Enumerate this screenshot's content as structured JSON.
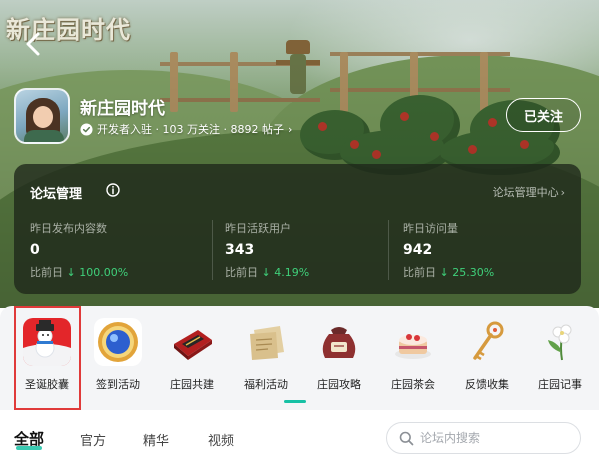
{
  "header": {
    "logo_text": "新庄园时代",
    "back_icon": "back-arrow-icon"
  },
  "forum": {
    "name": "新庄园时代",
    "verified_icon": "verified-shield-icon",
    "meta": "开发者入驻 · 103 万关注 · 8892 帖子",
    "meta_chevron": "›",
    "follow_label": "已关注"
  },
  "management": {
    "title": "论坛管理",
    "center_link": "论坛管理中心",
    "center_chevron": "›",
    "stats": [
      {
        "label": "昨日发布内容数",
        "value": "0",
        "change_prefix": "比前日",
        "change": "↓ 100.00%"
      },
      {
        "label": "昨日活跃用户",
        "value": "343",
        "change_prefix": "比前日",
        "change": "↓ 4.19%"
      },
      {
        "label": "昨日访问量",
        "value": "942",
        "change_prefix": "比前日",
        "change": "↓ 25.30%"
      }
    ]
  },
  "categories": [
    {
      "label": "圣诞胶囊",
      "icon": "christmas-capsule-icon"
    },
    {
      "label": "签到活动",
      "icon": "checkin-badge-icon"
    },
    {
      "label": "庄园共建",
      "icon": "build-box-icon"
    },
    {
      "label": "福利活动",
      "icon": "welfare-envelope-icon"
    },
    {
      "label": "庄园攻略",
      "icon": "guide-sack-icon"
    },
    {
      "label": "庄园茶会",
      "icon": "tea-cake-icon"
    },
    {
      "label": "反馈收集",
      "icon": "feedback-key-icon"
    },
    {
      "label": "庄园记事",
      "icon": "notes-flower-icon"
    }
  ],
  "tabs": [
    {
      "label": "全部",
      "active": true
    },
    {
      "label": "官方",
      "active": false
    },
    {
      "label": "精华",
      "active": false
    },
    {
      "label": "视频",
      "active": false
    }
  ],
  "search": {
    "placeholder": "论坛内搜索",
    "icon": "search-icon"
  },
  "colors": {
    "accent": "#17c1a5",
    "positive_delta": "#3fd07a",
    "highlight_border": "#e03a3a"
  }
}
